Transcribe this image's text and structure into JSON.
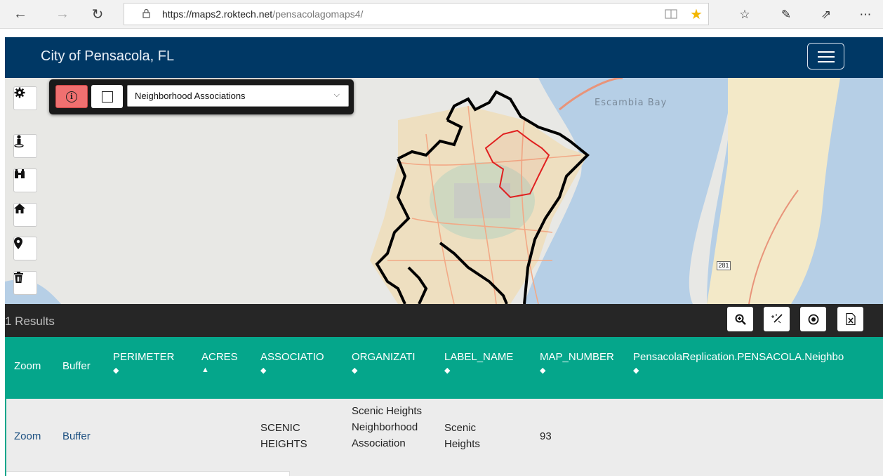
{
  "browser": {
    "url_host": "https://maps2.roktech.net",
    "url_path": "/pensacolagomaps4/",
    "nav_icons": [
      "back-arrow-icon",
      "forward-arrow-icon",
      "refresh-icon"
    ],
    "toolbar_icons": [
      "reading-view-icon",
      "favorite-star-icon",
      "favorites-hub-icon",
      "pen-icon",
      "share-icon",
      "more-icon"
    ]
  },
  "header": {
    "title": "City of Pensacola, FL"
  },
  "map": {
    "layer_select_value": "Neighborhood Associations",
    "water_label": "Escambia Bay",
    "route_label": "281",
    "tools": [
      "gear-icon",
      "person-icon",
      "binoculars-icon",
      "home-icon",
      "map-marker-icon",
      "trash-icon"
    ]
  },
  "results": {
    "count_label": "1 Results",
    "buttons": [
      "zoom-in-icon",
      "magic-wand-icon",
      "target-icon",
      "excel-export-icon"
    ]
  },
  "table": {
    "columns": [
      {
        "label": "Zoom",
        "sort": ""
      },
      {
        "label": "Buffer",
        "sort": ""
      },
      {
        "label": "PERIMETER",
        "sort": "◆"
      },
      {
        "label": "ACRES",
        "sort": "▲"
      },
      {
        "label": "ASSOCIATIO",
        "sort": "◆"
      },
      {
        "label": "ORGANIZATI",
        "sort": "◆"
      },
      {
        "label": "LABEL_NAME",
        "sort": "◆"
      },
      {
        "label": "MAP_NUMBER",
        "sort": "◆"
      },
      {
        "label": "PensacolaReplication.PENSACOLA.Neighbo",
        "sort": "◆"
      }
    ],
    "rows": [
      {
        "zoom": "Zoom",
        "buffer": "Buffer",
        "perimeter": "",
        "acres": "",
        "association": "SCENIC HEIGHTS",
        "organization": "Scenic Heights Neighborhood Association",
        "label_name": "Scenic Heights",
        "map_number": "93"
      }
    ]
  },
  "colors": {
    "header_bg": "#003865",
    "table_header_bg": "#05a68b",
    "results_bar_bg": "#262626",
    "info_button_bg": "#f07070",
    "boundary_highlight": "#e02020"
  }
}
